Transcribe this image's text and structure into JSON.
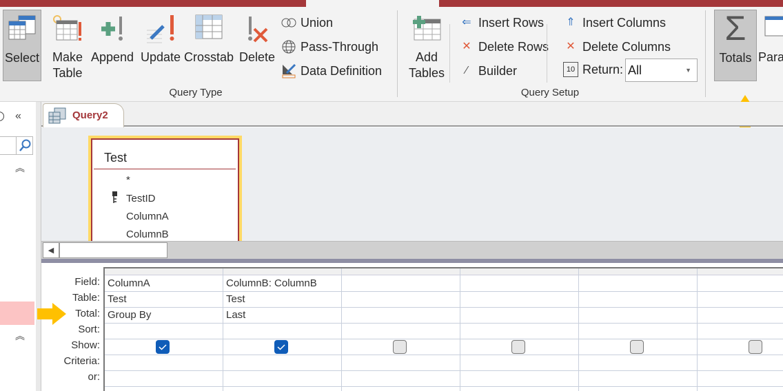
{
  "ribbon": {
    "query_type": {
      "group_label": "Query Type",
      "buttons": [
        {
          "label": "Select",
          "icon": "select-query-icon",
          "active": true
        },
        {
          "label": "Make\nTable",
          "icon": "make-table-icon"
        },
        {
          "label": "Append",
          "icon": "append-icon"
        },
        {
          "label": "Update",
          "icon": "update-icon"
        },
        {
          "label": "Crosstab",
          "icon": "crosstab-icon"
        },
        {
          "label": "Delete",
          "icon": "delete-query-icon"
        }
      ],
      "small": [
        {
          "label": "Union",
          "icon": "union-icon"
        },
        {
          "label": "Pass-Through",
          "icon": "globe-icon"
        },
        {
          "label": "Data Definition",
          "icon": "data-definition-icon"
        }
      ]
    },
    "query_setup": {
      "group_label": "Query Setup",
      "add_tables": "Add\nTables",
      "rows": [
        {
          "label": "Insert Rows"
        },
        {
          "label": "Delete Rows"
        },
        {
          "label": "Builder"
        }
      ],
      "cols": [
        {
          "label": "Insert Columns"
        },
        {
          "label": "Delete Columns"
        }
      ],
      "return_label": "Return:",
      "return_value": "All"
    },
    "totals": {
      "label": "Totals",
      "active": true
    },
    "parameters_partial": "Param"
  },
  "document_tab": {
    "label": "Query2"
  },
  "table_box": {
    "title": "Test",
    "fields": [
      "*",
      "TestID",
      "ColumnA",
      "ColumnB"
    ],
    "primary_key": "TestID"
  },
  "grid": {
    "row_labels": [
      "Field:",
      "Table:",
      "Total:",
      "Sort:",
      "Show:",
      "Criteria:",
      "or:"
    ],
    "columns": [
      {
        "field": "ColumnA",
        "table": "Test",
        "total": "Group By",
        "show": true
      },
      {
        "field": "ColumnB: ColumnB",
        "table": "Test",
        "total": "Last",
        "show": true
      },
      {
        "field": "",
        "table": "",
        "total": "",
        "show": false
      },
      {
        "field": "",
        "table": "",
        "total": "",
        "show": false
      },
      {
        "field": "",
        "table": "",
        "total": "",
        "show": false
      },
      {
        "field": "",
        "table": "",
        "total": "",
        "show": false
      }
    ]
  },
  "colors": {
    "accent": "#a4373a",
    "highlight_arrow": "#ffc000",
    "checkbox": "#0f5cb8"
  }
}
